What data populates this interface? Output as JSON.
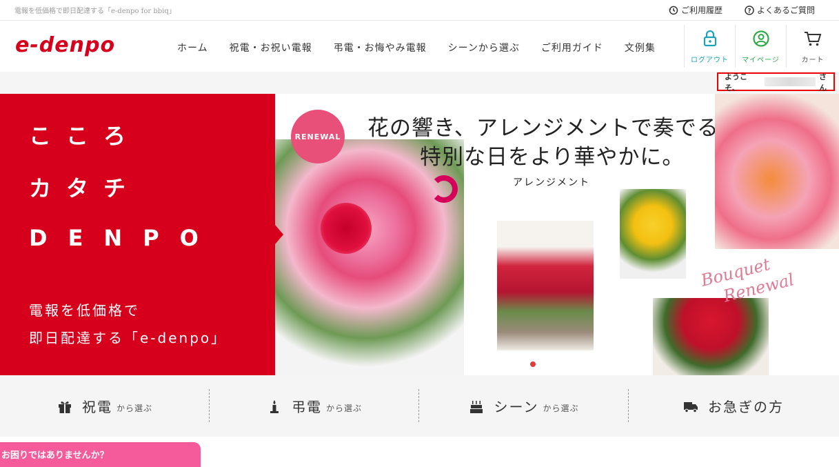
{
  "topbar": {
    "tagline": "電報を低価格で即日配達する「e-denpo for bbiq」",
    "history": "ご利用履歴",
    "faq": "よくあるご質問"
  },
  "header": {
    "logo": "e-denpo",
    "nav": [
      "ホーム",
      "祝電・お祝い電報",
      "弔電・お悔やみ電報",
      "シーンから選ぶ",
      "ご利用ガイド",
      "文例集"
    ],
    "logout": "ログアウト",
    "mypage": "マイページ",
    "cart": "カート"
  },
  "welcome": {
    "prefix": "ようこそ、",
    "suffix": "さん"
  },
  "hero": {
    "line1": "こころ",
    "line2": "カタチ",
    "line3": "DENPO",
    "sub1": "電報を低価格で",
    "sub2": "即日配達する「e-denpo」",
    "badge": "RENEWAL",
    "headline1": "花の響き、アレンジメントで奏でる。",
    "headline2": "特別な日をより華やかに。",
    "category_label": "アレンジメント",
    "script1": "Bouquet",
    "script2": "Renewal"
  },
  "categories": [
    {
      "name": "祝電",
      "sub": "から選ぶ",
      "icon": "gift-icon"
    },
    {
      "name": "弔電",
      "sub": "から選ぶ",
      "icon": "candle-icon"
    },
    {
      "name": "シーン",
      "sub": "から選ぶ",
      "icon": "cake-icon"
    },
    {
      "name": "お急ぎの方",
      "sub": "",
      "icon": "truck-icon"
    }
  ],
  "help": "お困りではありませんか？",
  "colors": {
    "brand_red": "#d6001c",
    "logout_teal": "#1aa3b8",
    "mypage_green": "#2eaa47",
    "help_pink": "#f55a9a",
    "badge_pink": "#e8507a"
  }
}
